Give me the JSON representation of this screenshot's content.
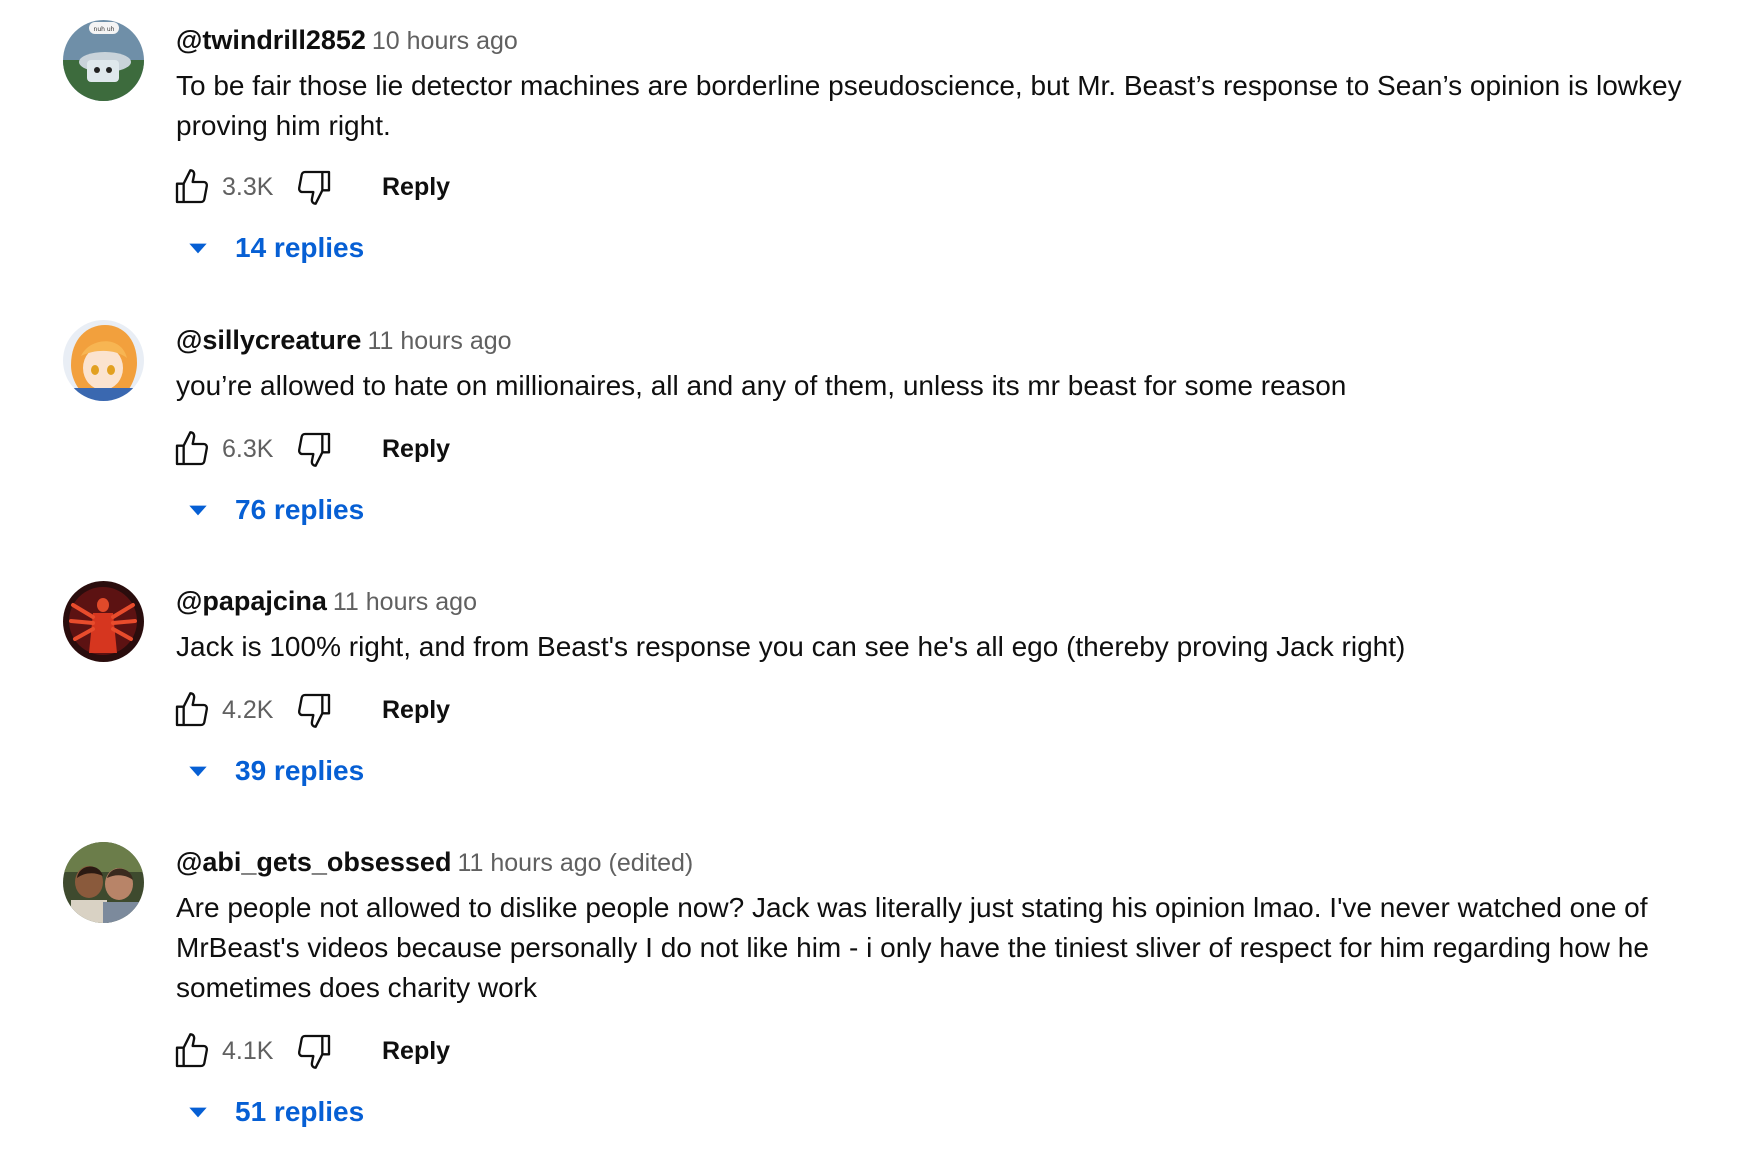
{
  "colors": {
    "link": "#065fd4",
    "secondary": "#606060",
    "primary": "#0f0f0f"
  },
  "comments": [
    {
      "author": "@twindrill2852",
      "time": "10 hours ago",
      "avatar_text": "nuh uh",
      "text": "To be fair those lie detector machines are borderline pseudoscience, but Mr. Beast’s response to Sean’s opinion is lowkey proving him right.",
      "likes": "3.3K",
      "reply_label": "Reply",
      "replies": "14 replies"
    },
    {
      "author": "@sillycreature",
      "time": "11 hours ago",
      "text": "you’re allowed to hate on millionaires, all and any of them, unless its mr beast for some reason",
      "likes": "6.3K",
      "reply_label": "Reply",
      "replies": "76 replies"
    },
    {
      "author": "@papajcina",
      "time": "11 hours ago",
      "text": "Jack is 100% right, and from Beast's response you can see he's all ego (thereby proving Jack right)",
      "likes": "4.2K",
      "reply_label": "Reply",
      "replies": "39 replies"
    },
    {
      "author": "@abi_gets_obsessed",
      "time": "11 hours ago (edited)",
      "text": "Are people not allowed to dislike people now? Jack was literally just stating his opinion lmao. I've never watched one of MrBeast's videos because personally I do not like him - i only have the tiniest sliver of respect for him regarding how he sometimes does charity work",
      "likes": "4.1K",
      "reply_label": "Reply",
      "replies": "51 replies"
    }
  ]
}
